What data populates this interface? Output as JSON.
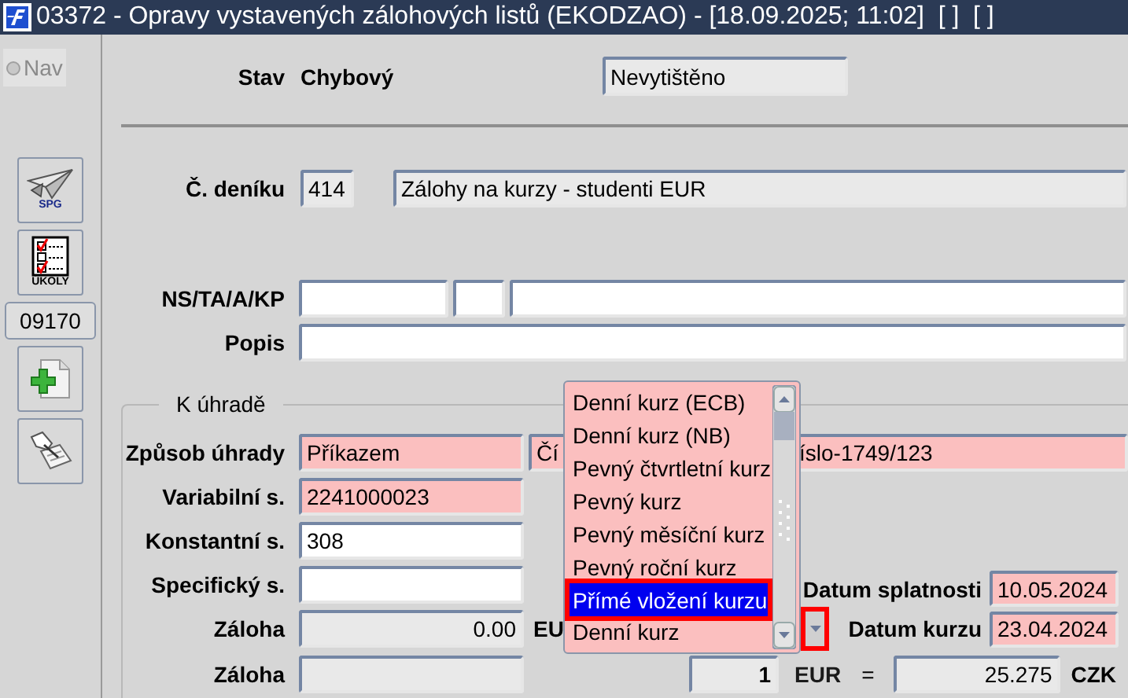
{
  "window": {
    "title": "03372 - Opravy vystavených zálohových listů (EKODZAO) - [18.09.2025; 11:02]  [ ]  [ ]"
  },
  "nav": {
    "label": "Nav",
    "selected": false
  },
  "toolbar": [
    {
      "kind": "plane",
      "caption": "SPG"
    },
    {
      "kind": "tasks",
      "caption": "ÚKOLY"
    },
    {
      "kind": "code",
      "text": "09170"
    },
    {
      "kind": "add"
    },
    {
      "kind": "edit"
    }
  ],
  "status": {
    "label": "Stav",
    "value": "Chybový",
    "print_state": {
      "value": "Nevytištěno",
      "kind": "readonly"
    }
  },
  "journal": {
    "label": "Č. deníku",
    "number": {
      "value": "414",
      "kind": "readonly"
    },
    "name": {
      "value": "Zálohy na kurzy - studenti EUR",
      "kind": "readonly"
    }
  },
  "ns": {
    "label": "NS/TA/A/KP",
    "fields": [
      {
        "kind": "editable"
      },
      {
        "kind": "editable"
      },
      {
        "kind": "editable"
      }
    ]
  },
  "popis": {
    "label": "Popis",
    "field": {
      "kind": "editable"
    }
  },
  "payment": {
    "title": "K úhradě",
    "rows": [
      {
        "label": "Způsob úhrady",
        "field": {
          "value": "Příkazem",
          "kind": "required"
        },
        "account": {
          "value_start": "Čí",
          "value_end": "íslo-1749/123",
          "kind": "required"
        }
      },
      {
        "label": "Variabilní s.",
        "field": {
          "value": "2241000023",
          "kind": "required"
        }
      },
      {
        "label": "Konstantní s.",
        "field": {
          "value": "308",
          "kind": "editable"
        }
      },
      {
        "label": "Specifický s.",
        "field": {
          "kind": "editable"
        },
        "due": {
          "label": "Datum splatnosti",
          "value": "10.05.2024",
          "kind": "required"
        }
      },
      {
        "label": "Záloha",
        "field": {
          "value": "0.00",
          "kind": "readonly"
        },
        "currency": "EU",
        "rate_date": {
          "label": "Datum kurzu",
          "value": "23.04.2024",
          "kind": "required",
          "button_highlighted": true
        }
      },
      {
        "label": "Záloha",
        "field": {
          "kind": "readonly"
        },
        "rate": {
          "amount": "1",
          "currency": "EUR",
          "equals": "=",
          "value": "25.275",
          "target": "CZK"
        }
      }
    ]
  },
  "rate_type_list": {
    "options": [
      {
        "label": "Denní kurz (ECB)",
        "selected": false,
        "highlighted": false
      },
      {
        "label": "Denní kurz (NB)",
        "selected": false,
        "highlighted": false
      },
      {
        "label": "Pevný čtvrtletní kurz",
        "selected": false,
        "highlighted": false
      },
      {
        "label": "Pevný kurz",
        "selected": false,
        "highlighted": false
      },
      {
        "label": "Pevný měsíční kurz",
        "selected": false,
        "highlighted": false
      },
      {
        "label": "Pevný roční kurz",
        "selected": false,
        "highlighted": false
      },
      {
        "label": "Přímé vložení kurzu",
        "selected": true,
        "highlighted": true
      },
      {
        "label": "Denní kurz",
        "selected": false,
        "highlighted": false
      }
    ]
  }
}
